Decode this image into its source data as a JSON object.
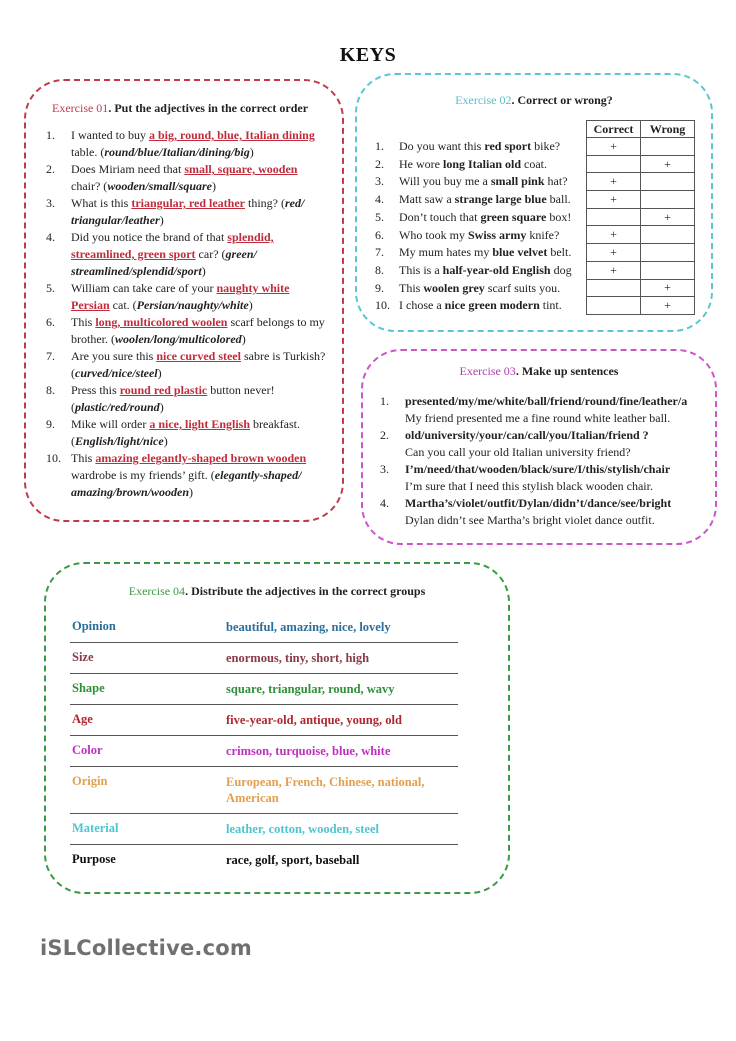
{
  "title": "KEYS",
  "exercise1": {
    "label": "Exercise 01",
    "instruction": ". Put the adjectives in the correct order",
    "color": "#c23a4a",
    "items": [
      {
        "num": "1.",
        "pre": "I wanted to buy ",
        "answer": "a big, round, blue, Italian dining",
        "post": " table. (",
        "hint": "round/blue/Italian/dining/big",
        "end": ")"
      },
      {
        "num": "2.",
        "pre": "Does Miriam need that ",
        "answer": "small, square, wooden",
        "post": " chair? (",
        "hint": "wooden/small/square",
        "end": ")"
      },
      {
        "num": "3.",
        "pre": "What is this ",
        "answer": "triangular, red leather",
        "post": " thing? (",
        "hint": "red/ triangular/leather",
        "end": ")"
      },
      {
        "num": "4.",
        "pre": "Did you notice the brand of that ",
        "answer": "splendid, streamlined, green sport",
        "post": " car? (",
        "hint": "green/ streamlined/splendid/sport",
        "end": ")"
      },
      {
        "num": "5.",
        "pre": "William can take care of your ",
        "answer": "naughty white Persian",
        "post": " cat. (",
        "hint": "Persian/naughty/white",
        "end": ")"
      },
      {
        "num": "6.",
        "pre": "This ",
        "answer": "long, multicolored woolen",
        "post": " scarf belongs to my brother. (",
        "hint": "woolen/long/multicolored",
        "end": ")"
      },
      {
        "num": "7.",
        "pre": "Are you sure this ",
        "answer": "nice curved steel",
        "post": " sabre is Turkish? (",
        "hint": "curved/nice/steel",
        "end": ")"
      },
      {
        "num": "8.",
        "pre": "Press this ",
        "answer": "round red plastic",
        "post": " button never! (",
        "hint": "plastic/red/round",
        "end": ")"
      },
      {
        "num": "9.",
        "pre": "Mike will order ",
        "answer": "a nice, light English",
        "post": " breakfast. (",
        "hint": "English/light/nice",
        "end": ")"
      },
      {
        "num": "10.",
        "pre": "This ",
        "answer": "amazing elegantly-shaped brown wooden",
        "post": " wardrobe is my friends’ gift. (",
        "hint": "elegantly-shaped/ amazing/brown/wooden",
        "end": ")"
      }
    ]
  },
  "exercise2": {
    "label": "Exercise 02",
    "instruction": ". Correct or wrong?",
    "color": "#5cbcc4",
    "columns": [
      "Correct",
      "Wrong"
    ],
    "mark": "+",
    "items": [
      {
        "num": "1.",
        "pre": "Do you want this ",
        "bold": "red sport",
        "post": " bike?",
        "correct": true,
        "wrong": false
      },
      {
        "num": "2.",
        "pre": "He wore ",
        "bold": "long Italian old",
        "post": " coat.",
        "correct": false,
        "wrong": true
      },
      {
        "num": "3.",
        "pre": "Will you buy me a ",
        "bold": "small pink",
        "post": " hat?",
        "correct": true,
        "wrong": false
      },
      {
        "num": "4.",
        "pre": "Matt saw a ",
        "bold": "strange large blue",
        "post": " ball.",
        "correct": true,
        "wrong": false
      },
      {
        "num": "5.",
        "pre": "Don’t touch that ",
        "bold": "green square",
        "post": " box!",
        "correct": false,
        "wrong": true
      },
      {
        "num": "6.",
        "pre": "Who took my ",
        "bold": "Swiss army",
        "post": " knife?",
        "correct": true,
        "wrong": false
      },
      {
        "num": "7.",
        "pre": "My mum hates my ",
        "bold": "blue velvet",
        "post": " belt.",
        "correct": true,
        "wrong": false
      },
      {
        "num": "8.",
        "pre": "This is a ",
        "bold": "half-year-old English",
        "post": " dog",
        "correct": true,
        "wrong": false
      },
      {
        "num": "9.",
        "pre": "This ",
        "bold": "woolen grey",
        "post": " scarf suits you.",
        "correct": false,
        "wrong": true
      },
      {
        "num": "10.",
        "pre": "I chose a ",
        "bold": "nice green modern",
        "post": " tint.",
        "correct": false,
        "wrong": true
      }
    ]
  },
  "exercise3": {
    "label": "Exercise 03",
    "instruction": ". Make up sentences",
    "color": "#b040b0",
    "items": [
      {
        "num": "1.",
        "prompt": "presented/my/me/white/ball/friend/round/fine/leather/a",
        "answer": "My friend presented me a fine round white leather ball."
      },
      {
        "num": "2.",
        "prompt": "old/university/your/can/call/you/Italian/friend ?",
        "answer": "Can you call your old Italian university friend?"
      },
      {
        "num": "3.",
        "prompt": "I’m/need/that/wooden/black/sure/I/this/stylish/chair",
        "answer": "I’m sure that I need this stylish black wooden chair."
      },
      {
        "num": "4.",
        "prompt": "Martha’s/violet/outfit/Dylan/didn’t/dance/see/bright",
        "answer": "Dylan didn’t see Martha’s bright violet dance outfit."
      }
    ]
  },
  "exercise4": {
    "label": "Exercise 04",
    "instruction": ". Distribute the adjectives in the correct groups",
    "color": "#3a9a44",
    "groups": [
      {
        "category": "Opinion",
        "words": "beautiful, amazing, nice, lovely",
        "color": "#2a6f9a"
      },
      {
        "category": "Size",
        "words": "enormous, tiny, short, high",
        "color": "#8a3a44"
      },
      {
        "category": "Shape",
        "words": "square, triangular, round, wavy",
        "color": "#2f8f3a"
      },
      {
        "category": "Age",
        "words": "five-year-old, antique, young, old",
        "color": "#b0262e"
      },
      {
        "category": "Color",
        "words": "crimson, turquoise, blue, white",
        "color": "#c030c0"
      },
      {
        "category": "Origin",
        "words": "European, French, Chinese, national, American",
        "color": "#e0a050"
      },
      {
        "category": "Material",
        "words": "leather, cotton, wooden, steel",
        "color": "#4ec4d0"
      },
      {
        "category": "Purpose",
        "words": "race, golf, sport, baseball",
        "color": "#111111"
      }
    ]
  },
  "footer": {
    "brand": "iSLCollective.com"
  }
}
